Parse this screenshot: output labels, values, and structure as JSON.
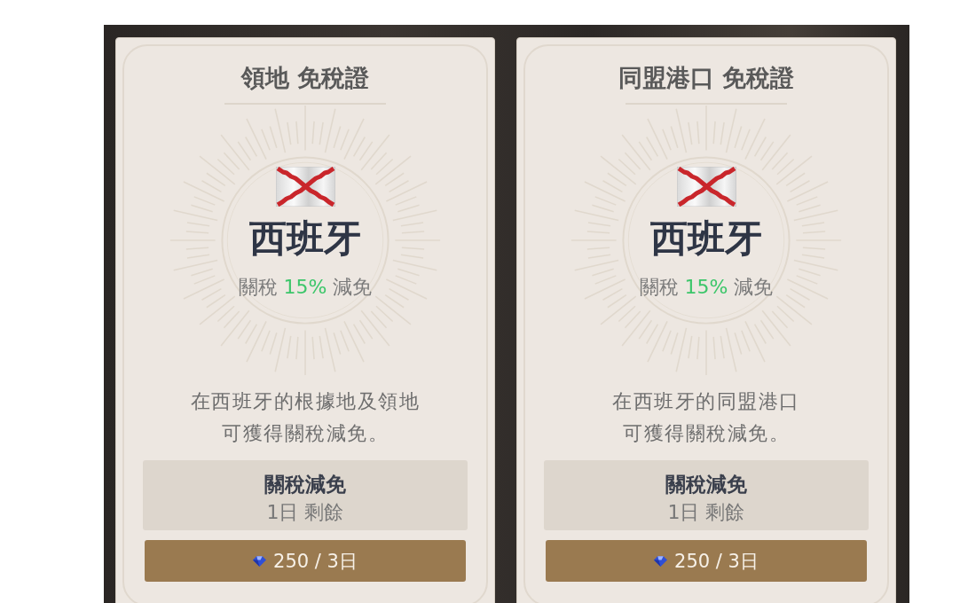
{
  "cards": [
    {
      "title": "領地 免稅證",
      "nation": "西班牙",
      "tariff": {
        "prefix": "關稅",
        "rate": "15%",
        "suffix": "減免"
      },
      "description_lines": [
        "在西班牙的根據地及領地",
        "可獲得關稅減免。"
      ],
      "status": {
        "label": "關稅減免",
        "remaining": "1日 剩餘"
      },
      "purchase_button": {
        "label": "250 / 3日"
      }
    },
    {
      "title": "同盟港口 免稅證",
      "nation": "西班牙",
      "tariff": {
        "prefix": "關稅",
        "rate": "15%",
        "suffix": "減免"
      },
      "description_lines": [
        "在西班牙的同盟港口",
        "可獲得關稅減免。"
      ],
      "status": {
        "label": "關稅減免",
        "remaining": "1日 剩餘"
      },
      "purchase_button": {
        "label": "250 / 3日"
      }
    }
  ]
}
